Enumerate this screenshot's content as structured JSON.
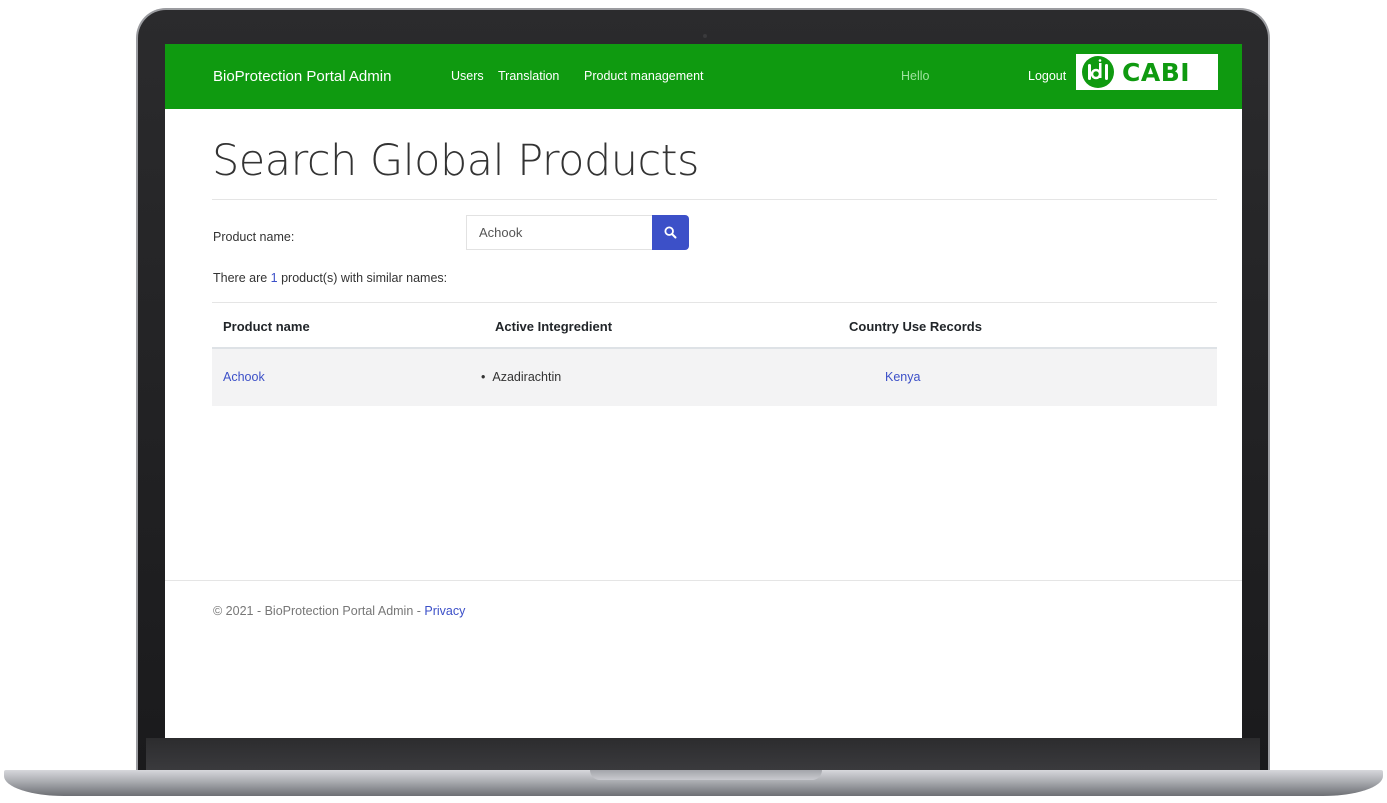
{
  "navbar": {
    "brand": "BioProtection Portal Admin",
    "links": [
      "Users",
      "Translation",
      "Product management"
    ],
    "greeting": "Hello",
    "logout": "Logout",
    "logo_text": "CABI"
  },
  "page": {
    "title": "Search Global Products"
  },
  "search": {
    "label": "Product name:",
    "value": "Achook"
  },
  "results": {
    "prefix": "There are ",
    "count": "1",
    "suffix": " product(s) with similar names:"
  },
  "table": {
    "headers": [
      "Product name",
      "Active Integredient",
      "Country Use Records"
    ],
    "rows": [
      {
        "product_name": "Achook",
        "active_ingredient": "Azadirachtin",
        "country": "Kenya"
      }
    ]
  },
  "footer": {
    "text": "© 2021 - BioProtection Portal Admin - ",
    "privacy": "Privacy"
  },
  "colors": {
    "navbar": "#0f9a10",
    "accent": "#3c50c8"
  }
}
